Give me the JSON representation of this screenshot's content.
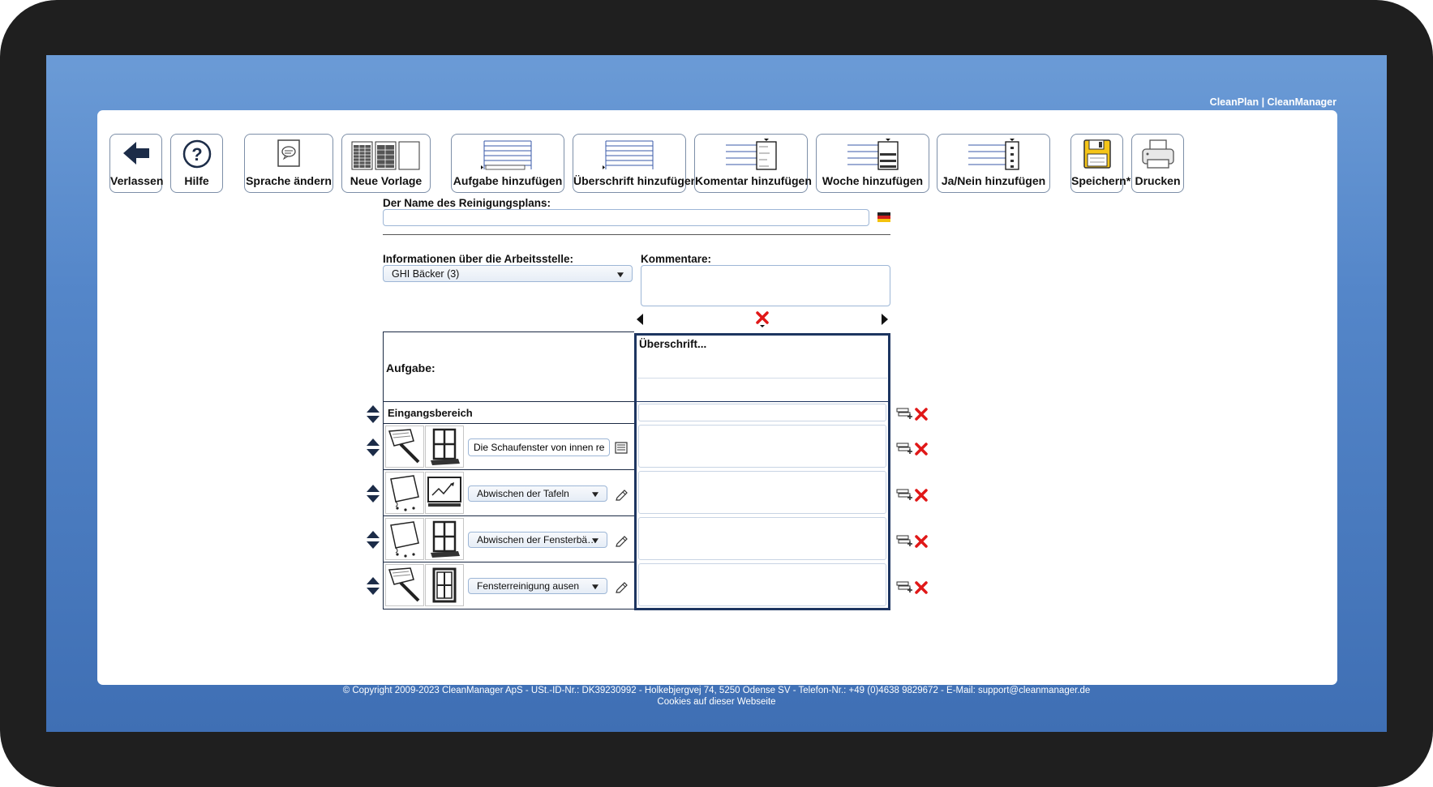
{
  "brand": "CleanPlan | CleanManager",
  "toolbar": {
    "leave": "Verlassen",
    "help": "Hilfe",
    "language": "Sprache ändern",
    "new_template": "Neue Vorlage",
    "add_task": "Aufgabe hinzufügen",
    "add_heading": "Überschrift hinzufügen",
    "add_comment": "Komentar hinzufügen",
    "add_week": "Woche hinzufügen",
    "add_yesno": "Ja/Nein hinzufügen",
    "save": "Speichern*",
    "print": "Drucken"
  },
  "form": {
    "plan_name_label": "Der Name des Reinigungsplans:",
    "plan_name_value": "",
    "workplace_label": "Informationen über die Arbeitsstelle:",
    "workplace_value": "GHI Bäcker (3)",
    "comments_label": "Kommentare:",
    "comments_value": ""
  },
  "table": {
    "task_header": "Aufgabe:",
    "column_header": "Überschrift...",
    "section": "Eingangsbereich",
    "rows": [
      {
        "task": "Die Schaufenster von innen reinig",
        "kind": "text"
      },
      {
        "task": "Abwischen der Tafeln",
        "kind": "select"
      },
      {
        "task": "Abwischen der Fensterbä…",
        "kind": "select"
      },
      {
        "task": "Fensterreinigung ausen",
        "kind": "select"
      }
    ]
  },
  "footer": {
    "copyright": "© Copyright 2009-2023 CleanManager ApS - USt.-ID-Nr.: DK39230992 - Holkebjergvej 74, 5250 Odense SV - Telefon-Nr.: +49 (0)4638 9829672 - E-Mail: support@cleanmanager.de",
    "cookies": "Cookies auf dieser Webseite"
  },
  "colors": {
    "background_blue": "#4f7fc2",
    "column_border": "#1d3560",
    "delete_red": "#e01818",
    "save_yellow": "#f5c518"
  }
}
